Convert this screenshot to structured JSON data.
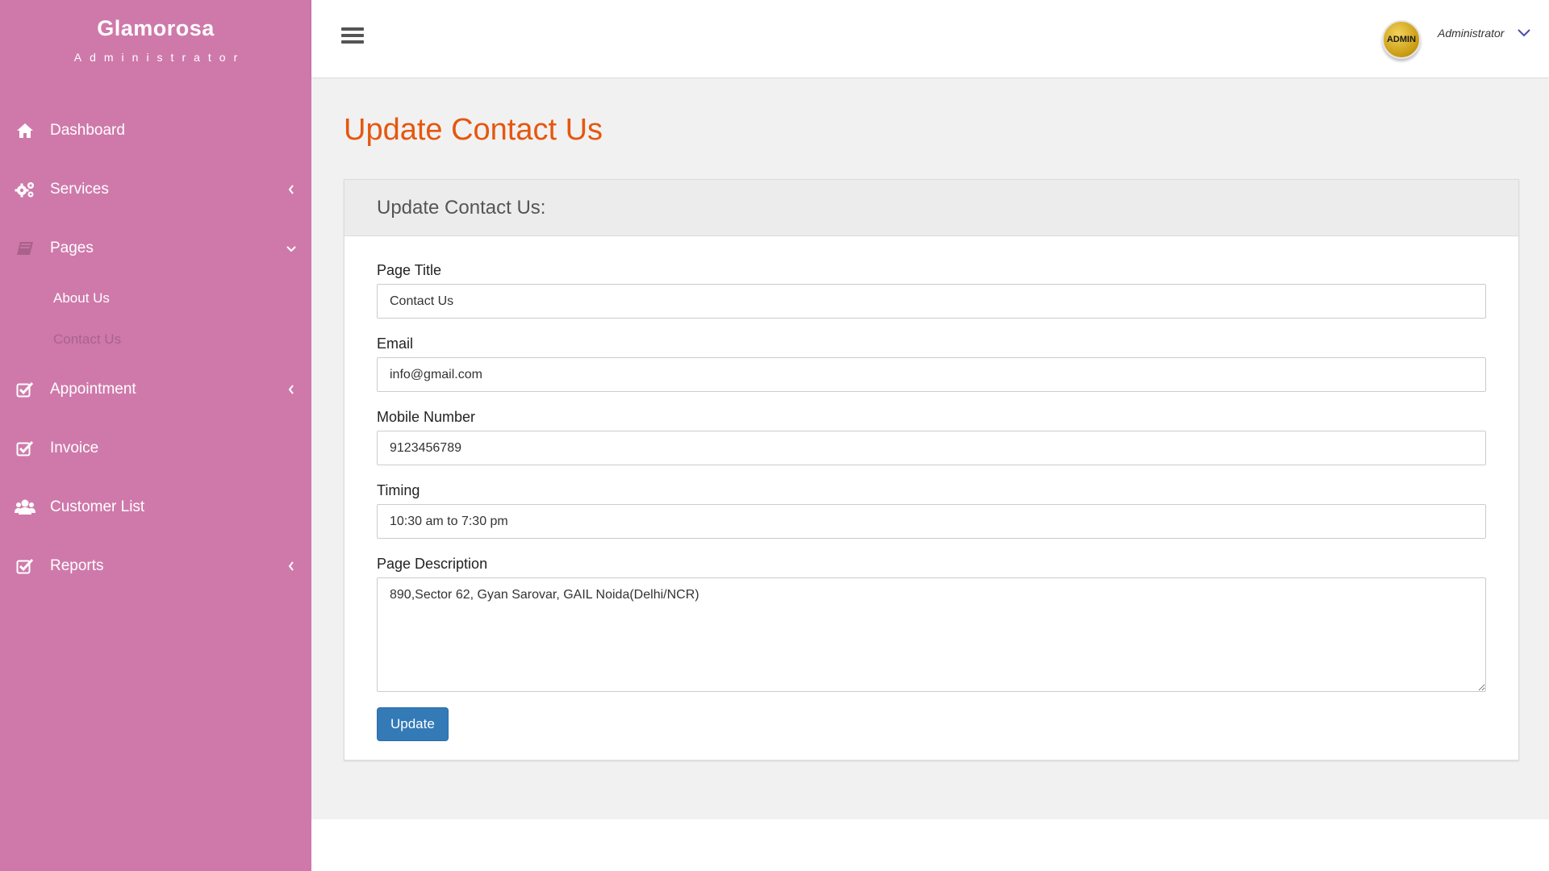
{
  "brand": {
    "name": "Glamorosa",
    "subtitle": "Administrator"
  },
  "sidebar": {
    "items": [
      {
        "label": "Dashboard",
        "icon": "home-icon"
      },
      {
        "label": "Services",
        "icon": "gears-icon",
        "chevron": "chevron-left-icon"
      },
      {
        "label": "Pages",
        "icon": "book-icon",
        "chevron": "chevron-down-icon"
      },
      {
        "label": "Appointment",
        "icon": "check-square-icon",
        "chevron": "chevron-left-icon"
      },
      {
        "label": "Invoice",
        "icon": "check-square-icon"
      },
      {
        "label": "Customer List",
        "icon": "users-icon"
      },
      {
        "label": "Reports",
        "icon": "check-square-icon",
        "chevron": "chevron-left-icon"
      }
    ],
    "pages_sub": [
      {
        "label": "About Us"
      },
      {
        "label": "Contact Us",
        "active": true
      }
    ]
  },
  "topbar": {
    "avatar_text": "ADMIN",
    "user_name": "Administrator"
  },
  "main": {
    "page_title": "Update Contact Us",
    "card_title": "Update Contact Us:",
    "fields": {
      "page_title": {
        "label": "Page Title",
        "value": "Contact Us"
      },
      "email": {
        "label": "Email",
        "value": "info@gmail.com"
      },
      "mobile": {
        "label": "Mobile Number",
        "value": "9123456789"
      },
      "timing": {
        "label": "Timing",
        "value": "10:30 am to 7:30 pm"
      },
      "description": {
        "label": "Page Description",
        "value": "890,Sector 62, Gyan Sarovar, GAIL Noida(Delhi/NCR)"
      }
    },
    "submit_label": "Update"
  },
  "colors": {
    "sidebar": "#cf79ab",
    "title_accent": "#e5570f",
    "button": "#337ab7",
    "active_sub": "#a9628a"
  }
}
